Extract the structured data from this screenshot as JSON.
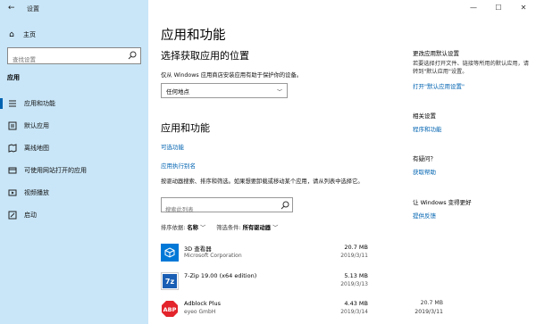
{
  "window": {
    "title": "设置",
    "minimize": "—",
    "maximize": "☐",
    "close": "✕"
  },
  "sidebar": {
    "home_label": "主页",
    "search_placeholder": "查找设置",
    "section": "应用",
    "items": [
      {
        "label": "应用和功能",
        "icon": "list-icon"
      },
      {
        "label": "默认应用",
        "icon": "default-apps-icon"
      },
      {
        "label": "离线地图",
        "icon": "map-icon"
      },
      {
        "label": "可使用网站打开的应用",
        "icon": "website-icon"
      },
      {
        "label": "视频播放",
        "icon": "video-icon"
      },
      {
        "label": "启动",
        "icon": "startup-icon"
      }
    ]
  },
  "main": {
    "title": "应用和功能",
    "install_heading": "选择获取应用的位置",
    "install_desc": "仅从 Windows 应用商店安装应用有助于保护你的设备。",
    "install_dropdown": "任何地点",
    "apps_heading": "应用和功能",
    "optional_features": "可选功能",
    "app_aliases": "应用执行别名",
    "search_desc": "按驱动器搜索、排序和筛选。如果想要卸载或移动某个应用，请从列表中选择它。",
    "app_search_placeholder": "搜索此列表",
    "sort_label": "排序依据:",
    "sort_value": "名称",
    "filter_label": "筛选条件:",
    "filter_value": "所有驱动器",
    "apps": [
      {
        "name": "3D 查看器",
        "publisher": "Microsoft Corporation",
        "size": "20.7 MB",
        "date": "2019/3/11"
      },
      {
        "name": "7-Zip 19.00 (x64 edition)",
        "publisher": "",
        "size": "5.13 MB",
        "date": "2019/3/13"
      },
      {
        "name": "Adblock Plus",
        "publisher": "eyeo GmbH",
        "size": "4.43 MB",
        "date": "2019/3/14"
      }
    ]
  },
  "right_panel": {
    "default_title": "更改应用默认设置",
    "default_desc": "若要选择打开文件、链接等所用的默认应用，请转到\"默认应用\"设置。",
    "default_link": "打开\"默认应用设置\"",
    "related_title": "相关设置",
    "related_link": "程序和功能",
    "question_title": "有疑问？",
    "question_link": "获取帮助",
    "improve_title": "让 Windows 变得更好",
    "improve_link": "提供反馈",
    "ghost_size": "20.7 MB",
    "ghost_date": "2019/3/11"
  }
}
